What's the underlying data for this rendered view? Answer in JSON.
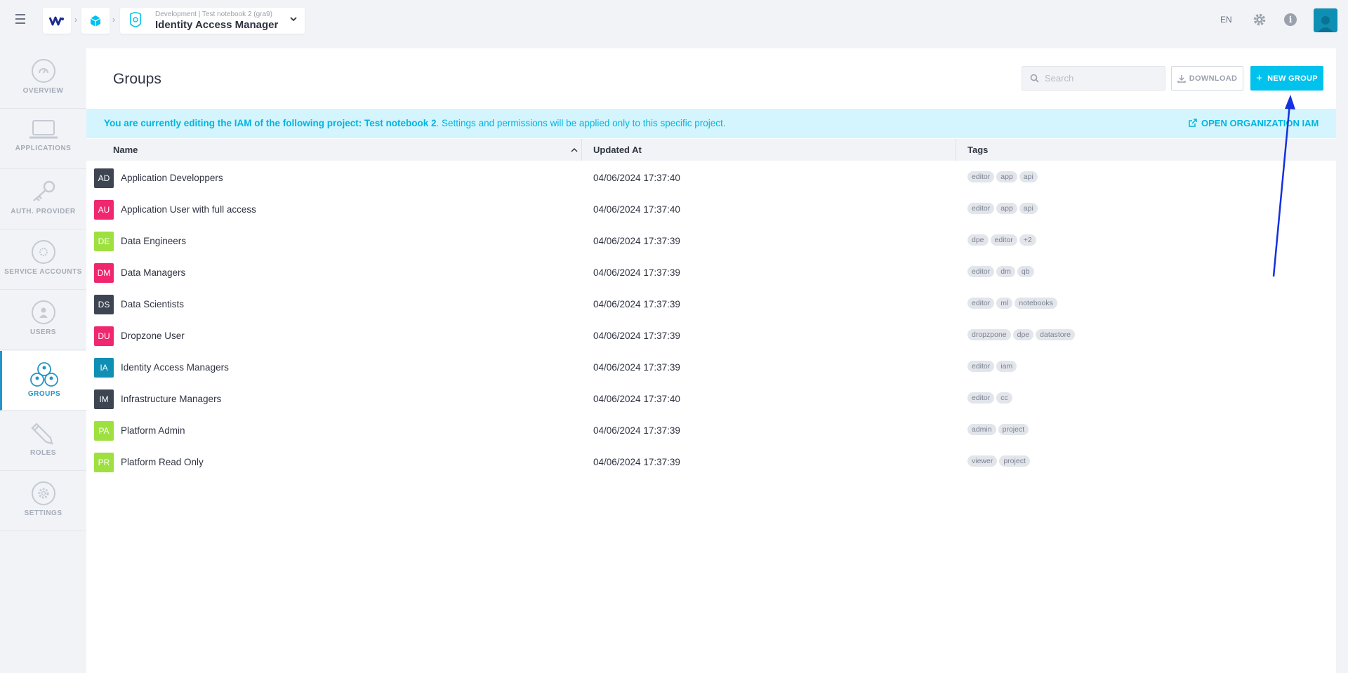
{
  "topbar": {
    "project_subline": "Development  |  Test notebook 2 (gra9)",
    "app_title": "Identity Access Manager",
    "language": "EN"
  },
  "sidebar": {
    "items": [
      {
        "label": "OVERVIEW"
      },
      {
        "label": "APPLICATIONS"
      },
      {
        "label": "AUTH. PROVIDER"
      },
      {
        "label": "SERVICE ACCOUNTS"
      },
      {
        "label": "USERS"
      },
      {
        "label": "GROUPS"
      },
      {
        "label": "ROLES"
      },
      {
        "label": "SETTINGS"
      }
    ],
    "active": "GROUPS"
  },
  "page": {
    "title": "Groups",
    "search_placeholder": "Search",
    "download_label": "DOWNLOAD",
    "new_group_label": "NEW GROUP"
  },
  "banner": {
    "bold_text": "You are currently editing the IAM of the following project: Test notebook 2",
    "rest_text": ". Settings and permissions will be applied only to this specific project.",
    "link_label": "OPEN ORGANIZATION IAM"
  },
  "table": {
    "headers": {
      "name": "Name",
      "updated": "Updated At",
      "tags": "Tags"
    },
    "rows": [
      {
        "initials": "AD",
        "color": "#3d4452",
        "name": "Application Developpers",
        "updated": "04/06/2024 17:37:40",
        "tags": [
          "editor",
          "app",
          "api"
        ]
      },
      {
        "initials": "AU",
        "color": "#f0276e",
        "name": "Application User with full access",
        "updated": "04/06/2024 17:37:40",
        "tags": [
          "editor",
          "app",
          "api"
        ]
      },
      {
        "initials": "DE",
        "color": "#9ee040",
        "name": "Data Engineers",
        "updated": "04/06/2024 17:37:39",
        "tags": [
          "dpe",
          "editor",
          "+2"
        ]
      },
      {
        "initials": "DM",
        "color": "#f0276e",
        "name": "Data Managers",
        "updated": "04/06/2024 17:37:39",
        "tags": [
          "editor",
          "dm",
          "qb"
        ]
      },
      {
        "initials": "DS",
        "color": "#3d4452",
        "name": "Data Scientists",
        "updated": "04/06/2024 17:37:39",
        "tags": [
          "editor",
          "ml",
          "notebooks"
        ]
      },
      {
        "initials": "DU",
        "color": "#f0276e",
        "name": "Dropzone User",
        "updated": "04/06/2024 17:37:39",
        "tags": [
          "dropzpone",
          "dpe",
          "datastore"
        ]
      },
      {
        "initials": "IA",
        "color": "#0e8fb3",
        "name": "Identity Access Managers",
        "updated": "04/06/2024 17:37:39",
        "tags": [
          "editor",
          "iam"
        ]
      },
      {
        "initials": "IM",
        "color": "#3d4452",
        "name": "Infrastructure Managers",
        "updated": "04/06/2024 17:37:40",
        "tags": [
          "editor",
          "cc"
        ]
      },
      {
        "initials": "PA",
        "color": "#9ee040",
        "name": "Platform Admin",
        "updated": "04/06/2024 17:37:39",
        "tags": [
          "admin",
          "project"
        ]
      },
      {
        "initials": "PR",
        "color": "#9ee040",
        "name": "Platform Read Only",
        "updated": "04/06/2024 17:37:39",
        "tags": [
          "viewer",
          "project"
        ]
      }
    ]
  },
  "colors": {
    "accent": "#00c2ec",
    "active_nav": "#2495c8",
    "annotation_arrow": "#1430e0"
  }
}
